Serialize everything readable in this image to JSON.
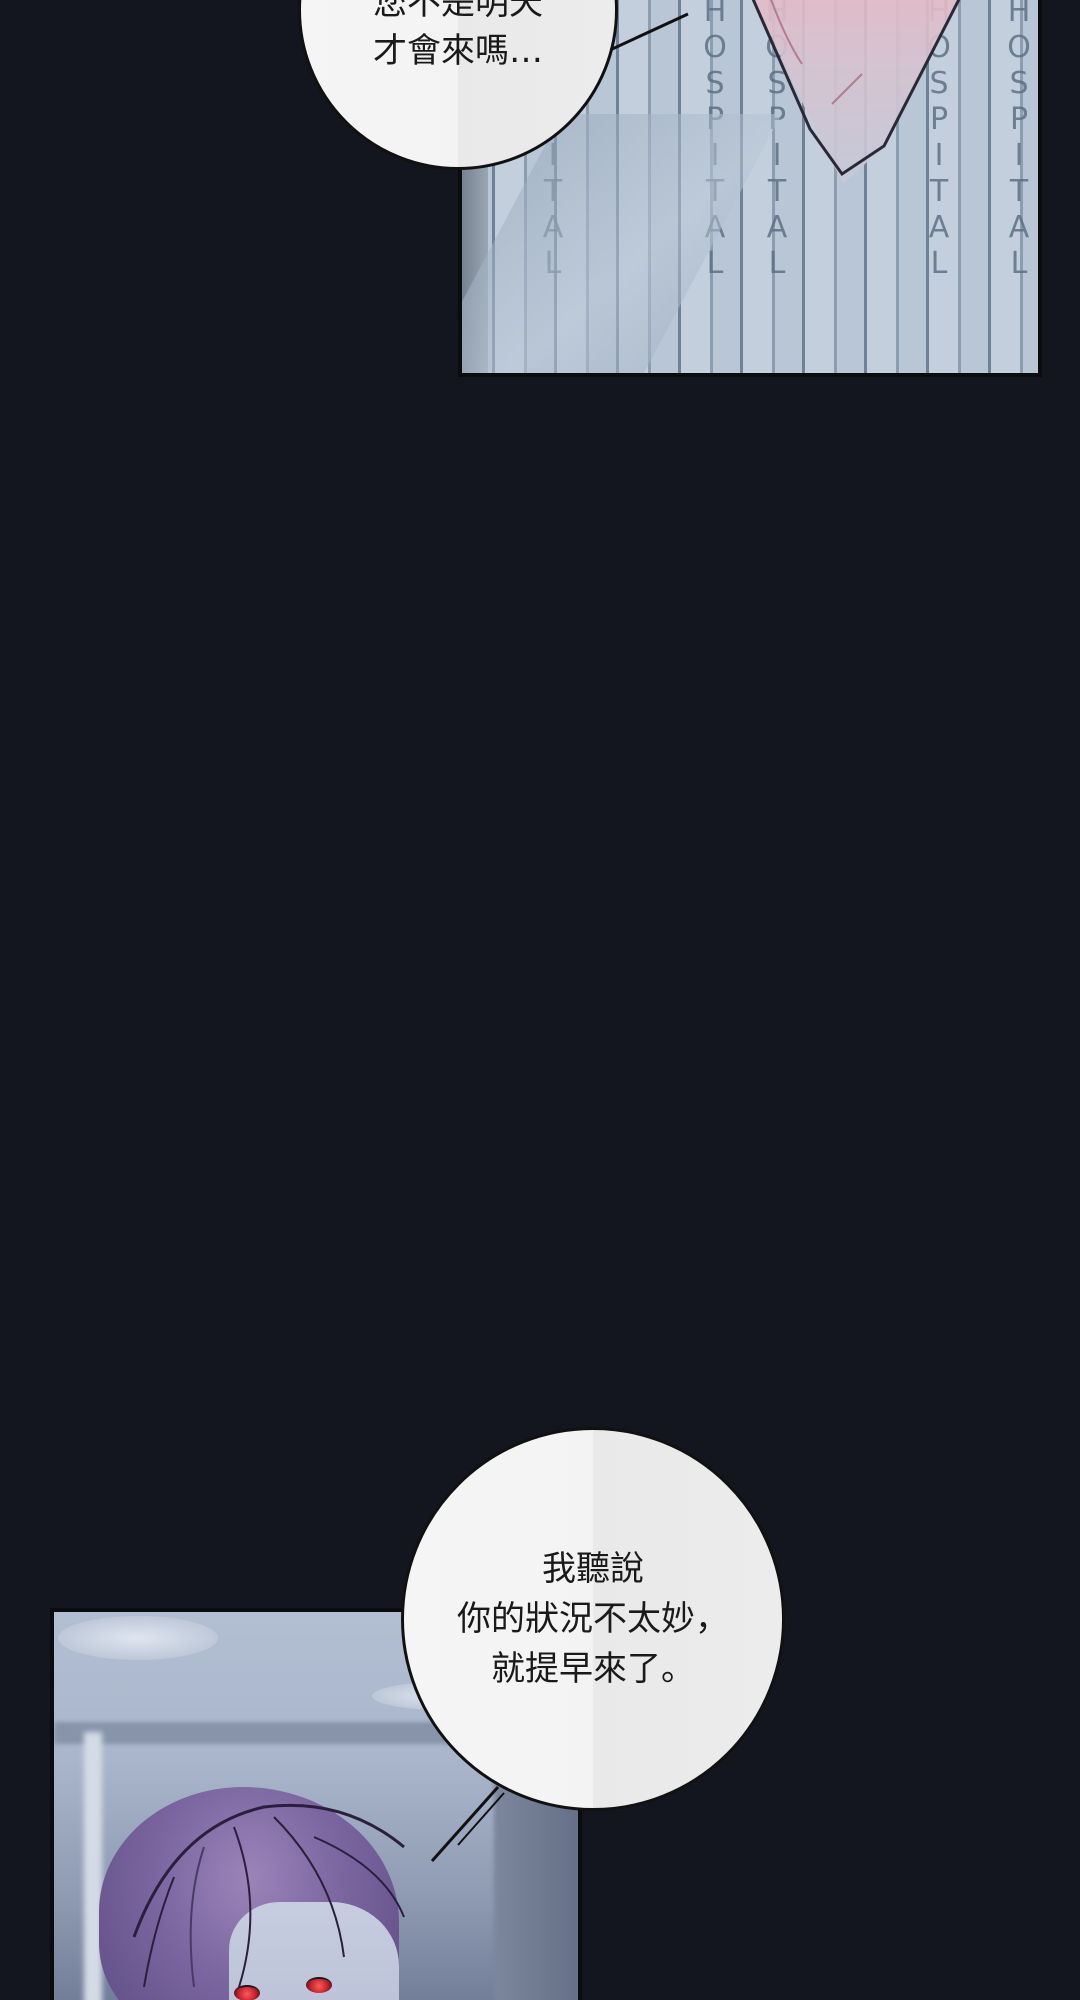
{
  "bubbles": {
    "top": {
      "lines": "您不是明天\n才會來嗎…"
    },
    "bottom": {
      "lines": "我聽說\n你的狀況不太妙，\n就提早來了。"
    }
  },
  "panel_top": {
    "gown_print": "HOSPITAL"
  },
  "colors": {
    "background": "#13161e",
    "gown": "#a6b6c8",
    "hair": "#7b65a0",
    "eyes": "#e0303a"
  }
}
